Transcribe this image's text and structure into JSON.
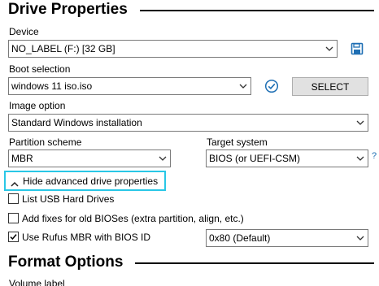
{
  "drive_properties": {
    "title": "Drive Properties",
    "device": {
      "label": "Device",
      "value": "NO_LABEL (F:) [32 GB]",
      "save_icon": "floppy-disk-icon"
    },
    "boot_selection": {
      "label": "Boot selection",
      "value": "windows 11 iso.iso",
      "check_icon": "check-circle-icon",
      "select_label": "SELECT"
    },
    "image_option": {
      "label": "Image option",
      "value": "Standard Windows installation"
    },
    "partition_scheme": {
      "label": "Partition scheme",
      "value": "MBR"
    },
    "target_system": {
      "label": "Target system",
      "value": "BIOS (or UEFI-CSM)",
      "help": "?"
    },
    "advanced": {
      "toggle_label": "Hide advanced drive properties",
      "list_usb": {
        "label": "List USB Hard Drives",
        "checked": false
      },
      "old_bios": {
        "label": "Add fixes for old BIOSes (extra partition, align, etc.)",
        "checked": false
      },
      "rufus_mbr": {
        "label": "Use Rufus MBR with BIOS ID",
        "checked": true,
        "bios_id": "0x80 (Default)"
      }
    }
  },
  "format_options": {
    "title": "Format Options",
    "volume_label": {
      "label": "Volume label"
    }
  },
  "colors": {
    "accent": "#29c7e6",
    "icon_blue": "#1f6fb4"
  }
}
